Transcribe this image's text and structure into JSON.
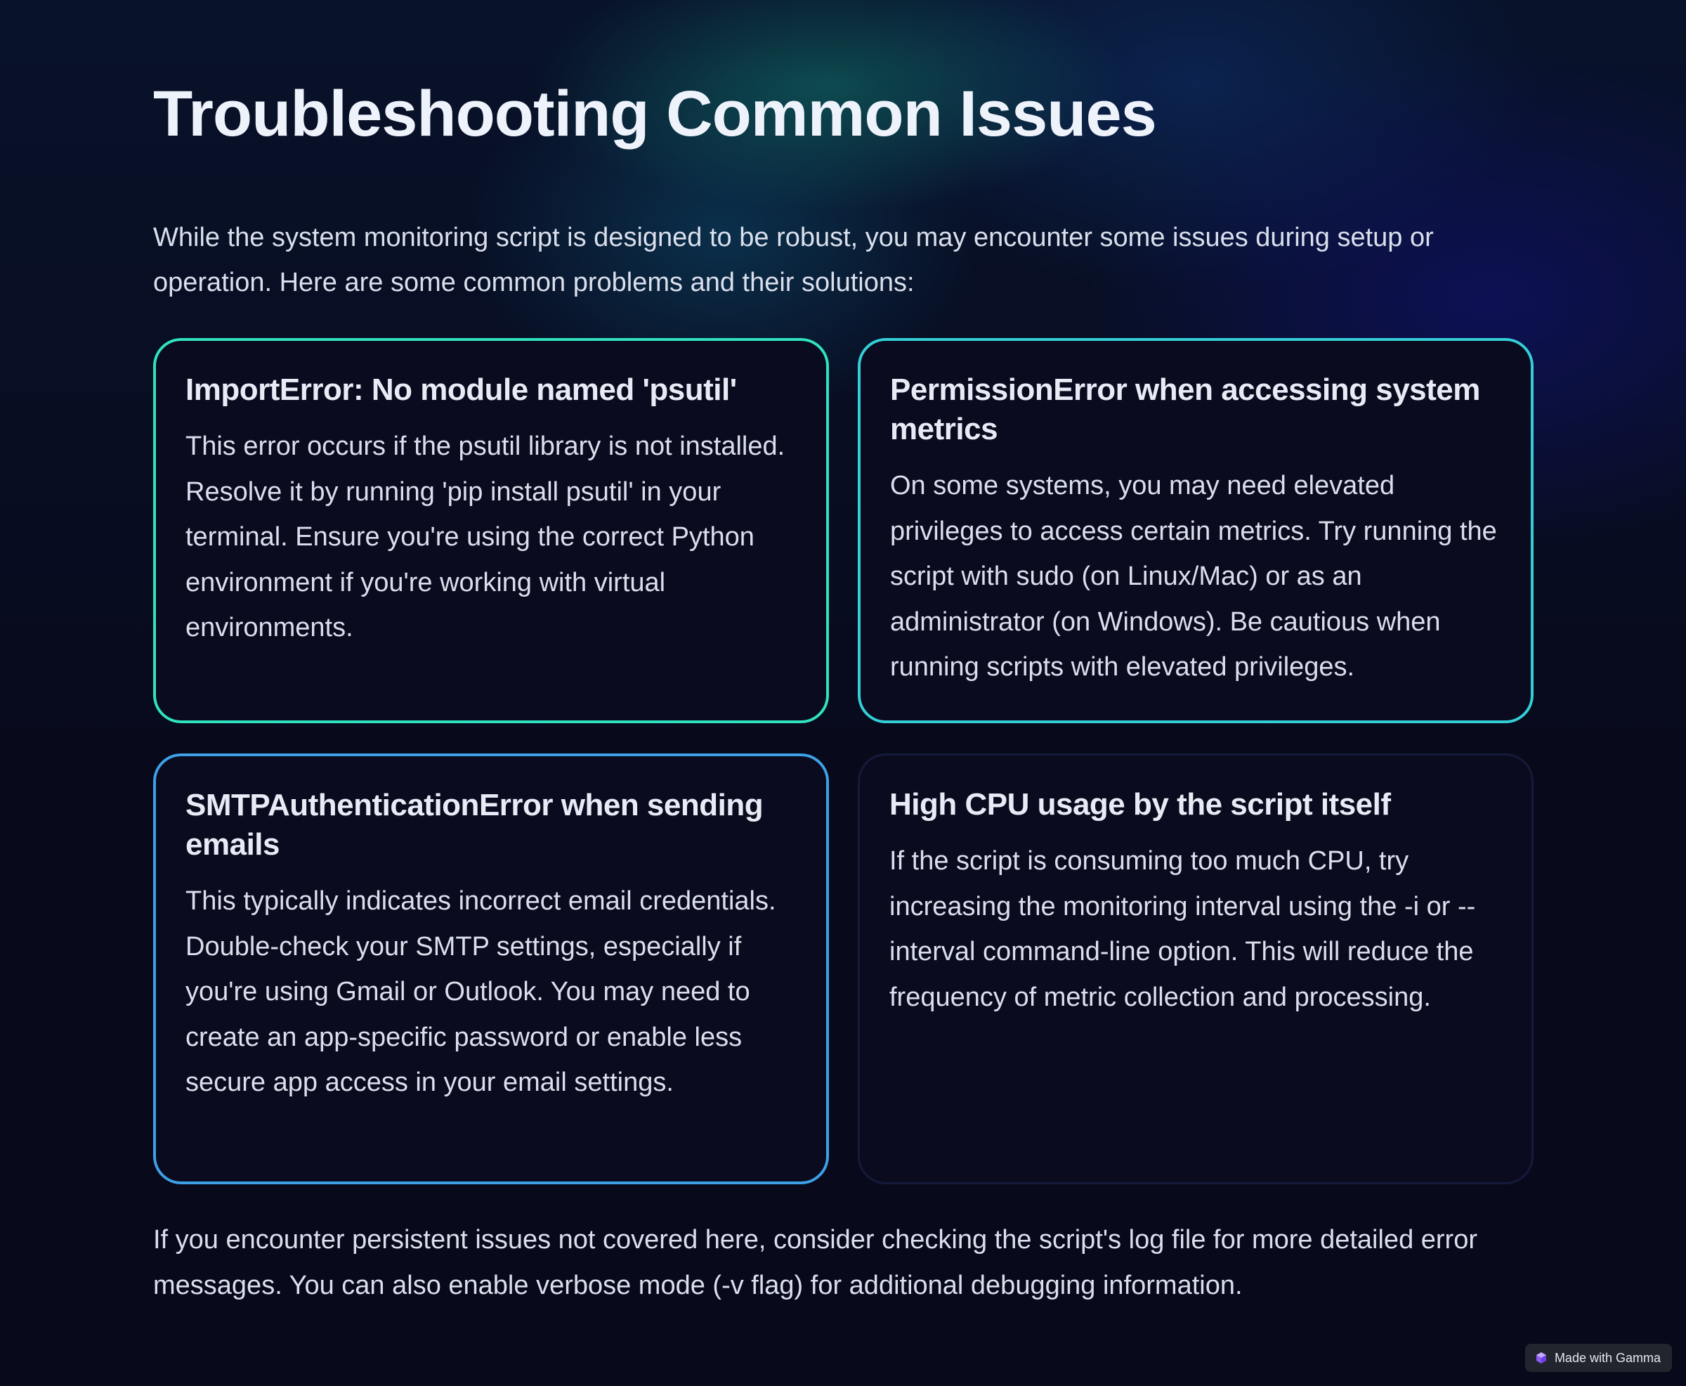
{
  "page": {
    "title": "Troubleshooting Common Issues",
    "intro": "While the system monitoring script is designed to be robust, you may encounter some issues during setup or operation. Here are some common problems and their solutions:",
    "outro": "If you encounter persistent issues not covered here, consider checking the script's log file for more detailed error messages. You can also enable verbose mode (-v flag) for additional debugging information."
  },
  "cards": [
    {
      "title": "ImportError: No module named 'psutil'",
      "body": "This error occurs if the psutil library is not installed. Resolve it by running 'pip install psutil' in your terminal. Ensure you're using the correct Python environment if you're working with virtual environments.",
      "accent": "#30e2bf"
    },
    {
      "title": "PermissionError when accessing system metrics",
      "body": "On some systems, you may need elevated privileges to access certain metrics. Try running the script with sudo (on Linux/Mac) or as an administrator (on Windows). Be cautious when running scripts with elevated privileges.",
      "accent": "#34cfd6"
    },
    {
      "title": "SMTPAuthenticationError when sending emails",
      "body": "This typically indicates incorrect email credentials. Double-check your SMTP settings, especially if you're using Gmail or Outlook. You may need to create an app-specific password or enable less secure app access in your email settings.",
      "accent": "#3ea0e6"
    },
    {
      "title": "High CPU usage by the script itself",
      "body": "If the script is consuming too much CPU, try increasing the monitoring interval using the -i or --interval command-line option. This will reduce the frequency of metric collection and processing.",
      "accent": "#151a3a"
    }
  ],
  "badge": {
    "label": "Made with Gamma",
    "icon": "gamma-logo-icon"
  },
  "colors": {
    "background": "#080a1c",
    "card_background": "#0a0b1e",
    "text": "#dadfec",
    "heading": "#eef2fb"
  }
}
